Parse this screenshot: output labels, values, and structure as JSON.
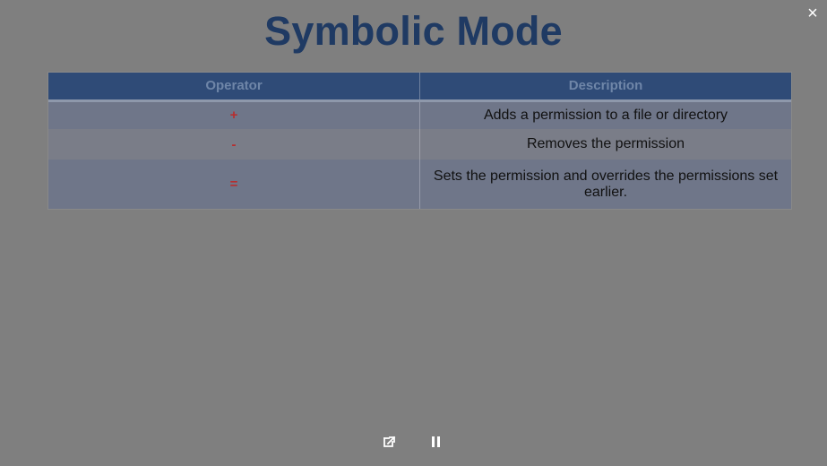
{
  "slide": {
    "title": "Symbolic Mode",
    "table": {
      "headers": {
        "operator": "Operator",
        "description": "Description"
      },
      "rows": [
        {
          "operator": "+",
          "description": "Adds a permission to a file or directory"
        },
        {
          "operator": "-",
          "description": "Removes the permission"
        },
        {
          "operator": "=",
          "description": "Sets the permission and overrides the permissions set earlier."
        }
      ]
    }
  },
  "window": {
    "close_label": "×"
  },
  "controls": {
    "open_external_icon": "open-external-icon",
    "pause_icon": "pause-icon"
  },
  "colors": {
    "background": "#7f7f7f",
    "title": "#1f3a63",
    "header_background": "#2f4b77",
    "operator_text": "#b72e2e",
    "description_text": "#111111"
  }
}
